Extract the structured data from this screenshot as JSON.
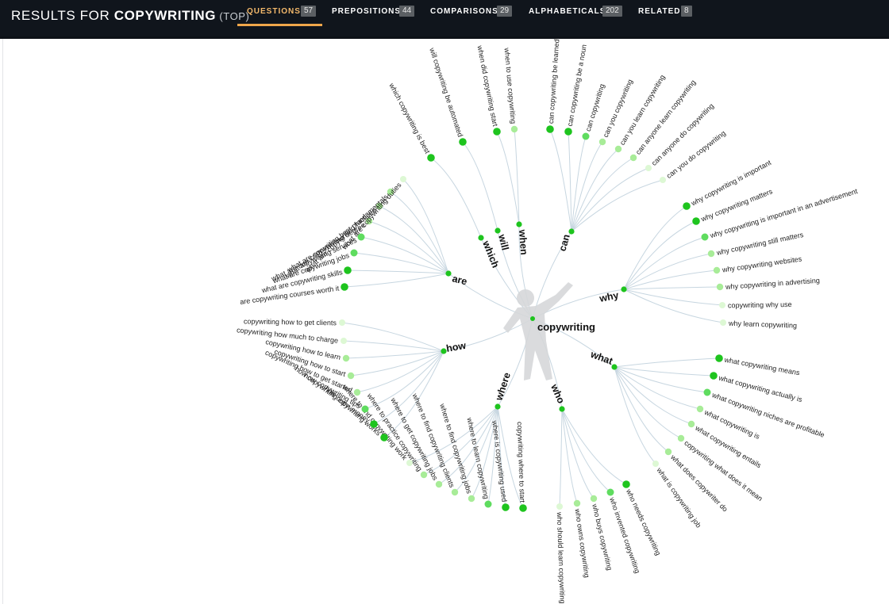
{
  "header": {
    "title_prefix": "RESULTS FOR ",
    "keyword": "COPYWRITING",
    "title_suffix": " (TOP)"
  },
  "tabs": [
    {
      "label": "QUESTIONS",
      "count": "57",
      "active": true
    },
    {
      "label": "PREPOSITIONS",
      "count": "44",
      "active": false
    },
    {
      "label": "COMPARISONS",
      "count": "29",
      "active": false
    },
    {
      "label": "ALPHABETICALS",
      "count": "202",
      "active": false
    },
    {
      "label": "RELATED",
      "count": "8",
      "active": false
    }
  ],
  "colors": {
    "accent": "#f0a64a",
    "topbar": "#10151c",
    "dot_strong": "#1ec41e",
    "dot_medium": "#5fdc5f",
    "dot_light": "#a8ec98",
    "dot_pale": "#ddf8d4",
    "branch_line": "#c7d6e0"
  },
  "wheel": {
    "center_label": "copywriting",
    "center_icon": "person-silhouette-icon",
    "branches": [
      {
        "label": "which",
        "items": [
          {
            "text": "which copywriting is best",
            "strength": 3
          }
        ]
      },
      {
        "label": "will",
        "items": [
          {
            "text": "will copywriting be automated",
            "strength": 3
          }
        ]
      },
      {
        "label": "when",
        "items": [
          {
            "text": "when did copywriting start",
            "strength": 3
          },
          {
            "text": "when to use copywriting",
            "strength": 1
          }
        ]
      },
      {
        "label": "can",
        "items": [
          {
            "text": "can copywriting be learned",
            "strength": 3
          },
          {
            "text": "can copywriting be a noun",
            "strength": 3
          },
          {
            "text": "can copywriting",
            "strength": 2
          },
          {
            "text": "can you copywriting",
            "strength": 1
          },
          {
            "text": "can you learn copywriting",
            "strength": 1
          },
          {
            "text": "can anyone learn copywriting",
            "strength": 1
          },
          {
            "text": "can anyone do copywriting",
            "strength": 0
          },
          {
            "text": "can you do copywriting",
            "strength": 0
          }
        ]
      },
      {
        "label": "why",
        "items": [
          {
            "text": "why copywriting is important",
            "strength": 3
          },
          {
            "text": "why copywriting matters",
            "strength": 3
          },
          {
            "text": "why copywriting is important in an advertisement",
            "strength": 2
          },
          {
            "text": "why copywriting still matters",
            "strength": 1
          },
          {
            "text": "why copywriting websites",
            "strength": 1
          },
          {
            "text": "why copywriting in advertising",
            "strength": 1
          },
          {
            "text": "copywriting why use",
            "strength": 0
          },
          {
            "text": "why learn copywriting",
            "strength": 0
          }
        ]
      },
      {
        "label": "what",
        "items": [
          {
            "text": "what copywriting means",
            "strength": 3
          },
          {
            "text": "what copywriting actually is",
            "strength": 3
          },
          {
            "text": "what copywriting niches are profitable",
            "strength": 2
          },
          {
            "text": "what copywriting is",
            "strength": 1
          },
          {
            "text": "what copywriting entails",
            "strength": 1
          },
          {
            "text": "copywriting what does it mean",
            "strength": 1
          },
          {
            "text": "what does copywriter do",
            "strength": 1
          },
          {
            "text": "what is copywriting job",
            "strength": 0
          }
        ]
      },
      {
        "label": "who",
        "items": [
          {
            "text": "who needs copywriting",
            "strength": 3
          },
          {
            "text": "who invented copywriting",
            "strength": 2
          },
          {
            "text": "who buys copywriting",
            "strength": 1
          },
          {
            "text": "who owns copywriting",
            "strength": 1
          },
          {
            "text": "who should learn copywriting",
            "strength": 0
          }
        ]
      },
      {
        "label": "where",
        "items": [
          {
            "text": "copywriting where to start",
            "strength": 3
          },
          {
            "text": "where is copywriting used",
            "strength": 3
          },
          {
            "text": "where to learn copywriting",
            "strength": 2
          },
          {
            "text": "where to find copywriting jobs",
            "strength": 1
          },
          {
            "text": "where to find copywriting clients",
            "strength": 1
          },
          {
            "text": "where to get copywriting jobs",
            "strength": 1
          },
          {
            "text": "where to practice copywriting",
            "strength": 1
          },
          {
            "text": "where to find copywriting work",
            "strength": 0
          }
        ]
      },
      {
        "label": "how",
        "items": [
          {
            "text": "how copywriting works",
            "strength": 3
          },
          {
            "text": "how copywriting earn money",
            "strength": 3
          },
          {
            "text": "how copywriting tips",
            "strength": 2
          },
          {
            "text": "copywriting how to get started",
            "strength": 1
          },
          {
            "text": "copywriting how to start",
            "strength": 1
          },
          {
            "text": "copywriting how to learn",
            "strength": 1
          },
          {
            "text": "copywriting how much to charge",
            "strength": 0
          },
          {
            "text": "copywriting how to get clients",
            "strength": 0
          }
        ]
      },
      {
        "label": "are",
        "items": [
          {
            "text": "are copywriting courses worth it",
            "strength": 3
          },
          {
            "text": "what are copywriting skills",
            "strength": 3
          },
          {
            "text": "what are copywriting jobs",
            "strength": 2
          },
          {
            "text": "what are copywriting services",
            "strength": 2
          },
          {
            "text": "what are copywriting degree",
            "strength": 1
          },
          {
            "text": "what are copywriting best practices",
            "strength": 1
          },
          {
            "text": "what are copywriting fundamentals",
            "strength": 1
          },
          {
            "text": "what are copywriting duties",
            "strength": 0
          }
        ]
      }
    ]
  }
}
